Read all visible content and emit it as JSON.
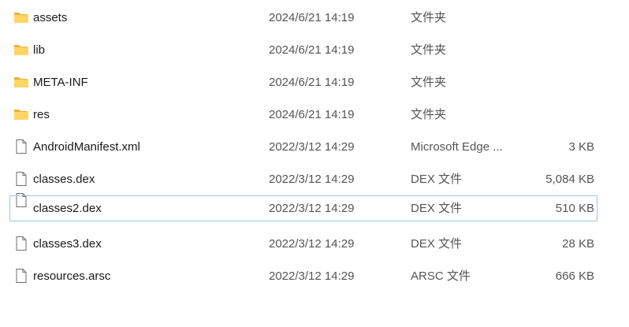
{
  "files": [
    {
      "name": "assets",
      "modified": "2024/6/21 14:19",
      "type": "文件夹",
      "size": "",
      "icon": "folder-icon",
      "kind": "folder"
    },
    {
      "name": "lib",
      "modified": "2024/6/21 14:19",
      "type": "文件夹",
      "size": "",
      "icon": "folder-icon",
      "kind": "folder"
    },
    {
      "name": "META-INF",
      "modified": "2024/6/21 14:19",
      "type": "文件夹",
      "size": "",
      "icon": "folder-icon",
      "kind": "folder"
    },
    {
      "name": "res",
      "modified": "2024/6/21 14:19",
      "type": "文件夹",
      "size": "",
      "icon": "folder-icon",
      "kind": "folder"
    },
    {
      "name": "AndroidManifest.xml",
      "modified": "2022/3/12 14:29",
      "type": "Microsoft Edge ...",
      "size": "3 KB",
      "icon": "file-icon",
      "kind": "file"
    },
    {
      "name": "classes.dex",
      "modified": "2022/3/12 14:29",
      "type": "DEX 文件",
      "size": "5,084 KB",
      "icon": "file-icon",
      "kind": "file"
    },
    {
      "name": "classes2.dex",
      "modified": "2022/3/12 14:29",
      "type": "DEX 文件",
      "size": "510 KB",
      "icon": "file-icon",
      "kind": "file",
      "hovered": true
    },
    {
      "name": "classes3.dex",
      "modified": "2022/3/12 14:29",
      "type": "DEX 文件",
      "size": "28 KB",
      "icon": "file-icon",
      "kind": "file"
    },
    {
      "name": "resources.arsc",
      "modified": "2022/3/12 14:29",
      "type": "ARSC 文件",
      "size": "666 KB",
      "icon": "file-icon",
      "kind": "file"
    }
  ],
  "colors": {
    "folder_back": "#e8b23a",
    "folder_front": "#ffd666",
    "file_outline": "#6e6e6e",
    "hover_border": "#9fc3d8"
  }
}
